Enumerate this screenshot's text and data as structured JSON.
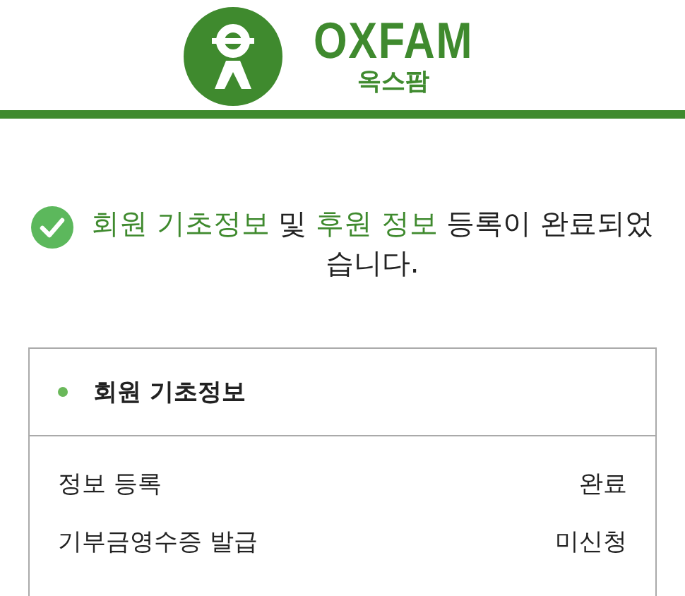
{
  "logo": {
    "name": "OXFAM",
    "subtitle": "옥스팜"
  },
  "message": {
    "parts": [
      {
        "text": "회원 기초정보",
        "highlight": true
      },
      {
        "text": " 및 ",
        "highlight": false
      },
      {
        "text": "후원 정보",
        "highlight": true
      },
      {
        "text": " 등록이 완료되었습니다.",
        "highlight": false
      }
    ]
  },
  "card": {
    "title": "회원 기초정보",
    "color": "#6ab85a",
    "rows": [
      {
        "label": "정보 등록",
        "value": "완료"
      },
      {
        "label": "기부금영수증 발급",
        "value": "미신청"
      }
    ]
  }
}
